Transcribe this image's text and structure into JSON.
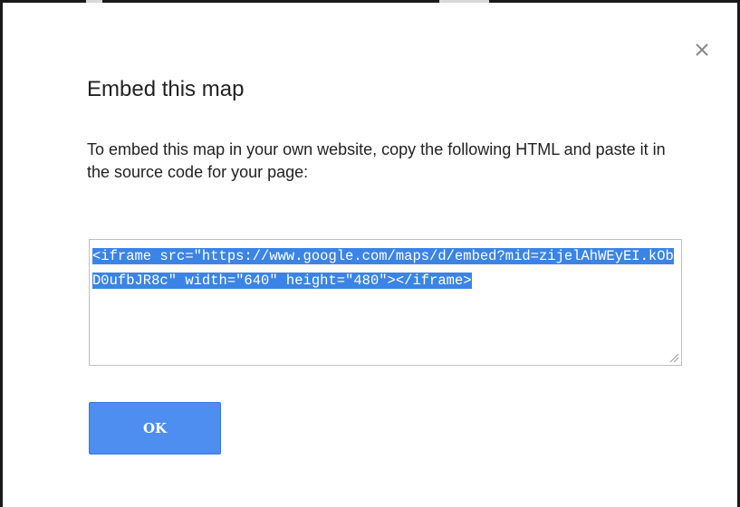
{
  "dialog": {
    "title": "Embed this map",
    "description": "To embed this map in your own website, copy the following HTML and paste it in the source code for your page:",
    "embed_code": "<iframe src=\"https://www.google.com/maps/d/embed?mid=zijelAhWEyEI.kObD0ufbJR8c\" width=\"640\" height=\"480\"></iframe>",
    "close_icon": "close-icon",
    "ok_label": "OK"
  },
  "colors": {
    "selection": "#3b84e6",
    "ok_button": "#4d8ef0",
    "text": "#222222",
    "border": "#bfbfbf"
  }
}
